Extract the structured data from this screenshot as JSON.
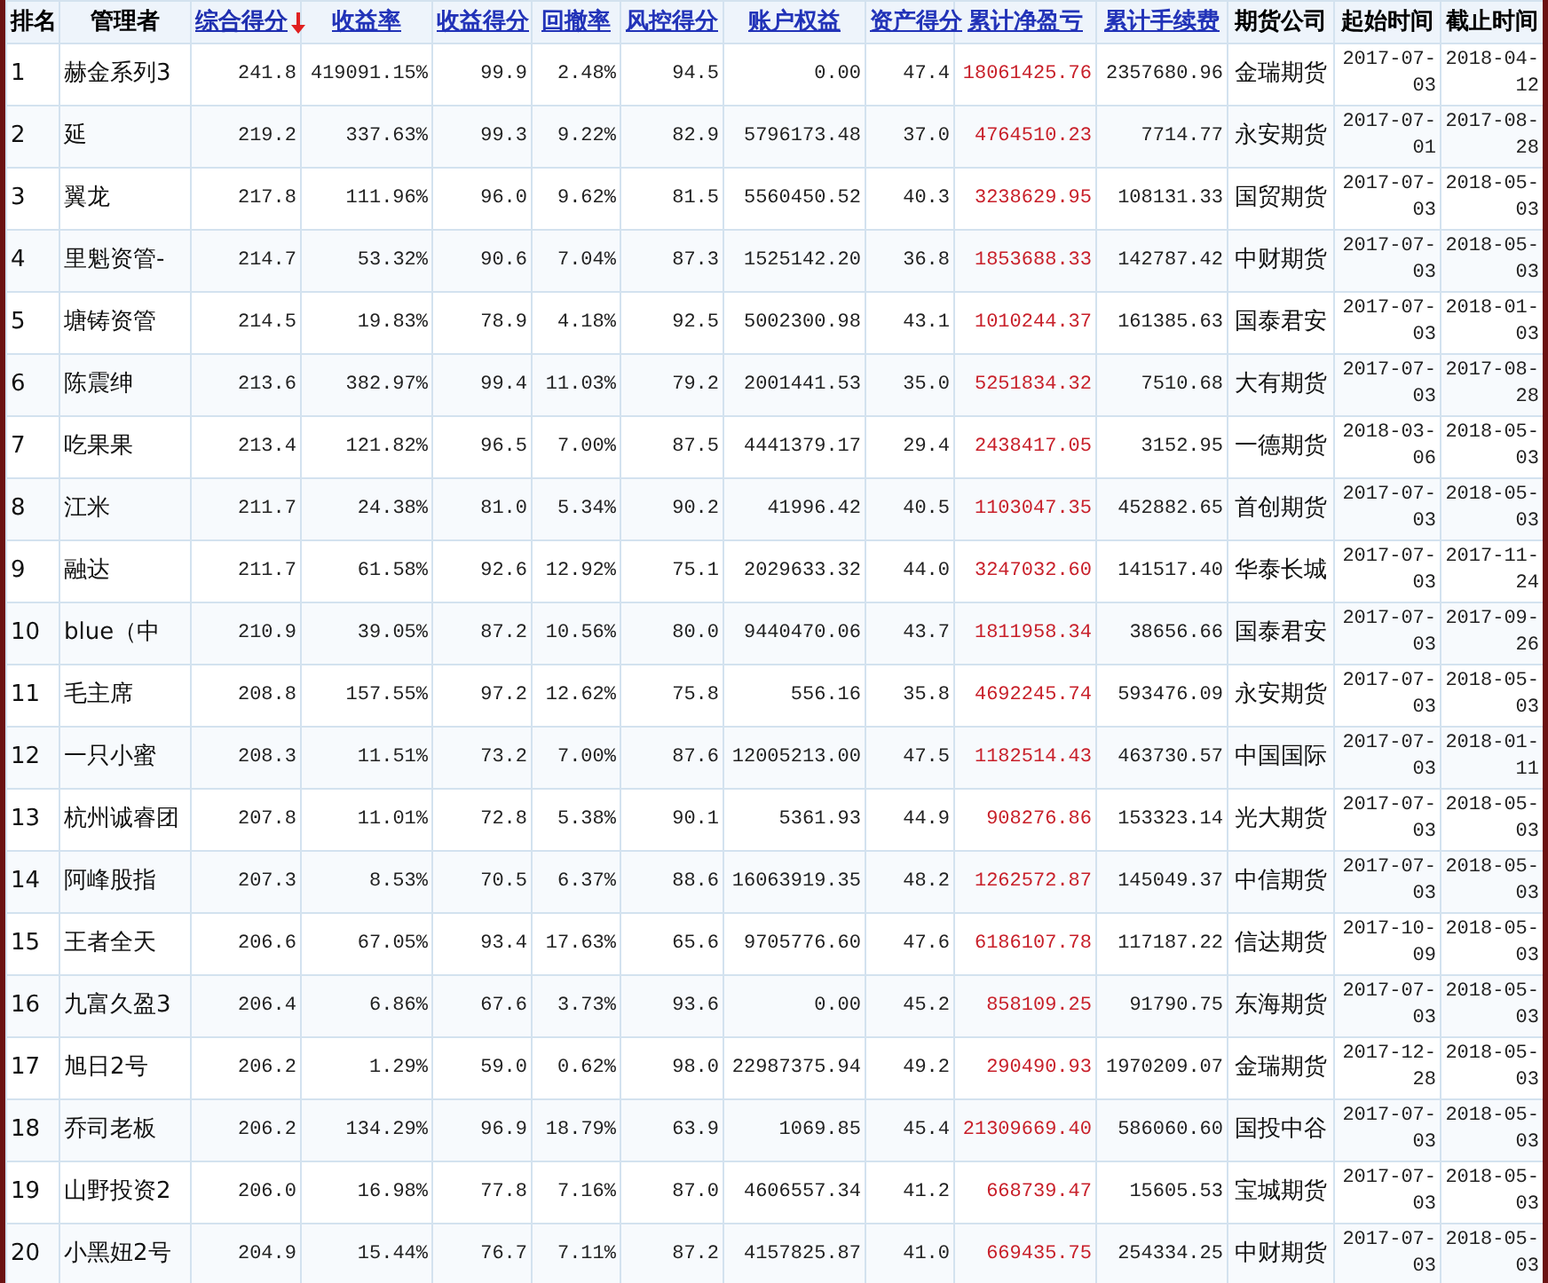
{
  "table": {
    "columns": [
      {
        "label": "排名",
        "kind": "plain"
      },
      {
        "label": "管理者",
        "kind": "plain"
      },
      {
        "label": "综合得分",
        "kind": "link",
        "sorted": true
      },
      {
        "label": "收益率",
        "kind": "link",
        "sorted": false
      },
      {
        "label": "收益得分",
        "kind": "link",
        "sorted": false
      },
      {
        "label": "回撤率",
        "kind": "link",
        "sorted": false
      },
      {
        "label": "风控得分",
        "kind": "link",
        "sorted": false
      },
      {
        "label": "账户权益",
        "kind": "link",
        "sorted": false
      },
      {
        "label": "资产得分",
        "kind": "link",
        "sorted": false
      },
      {
        "label": "累计净盈亏",
        "kind": "link",
        "sorted": false
      },
      {
        "label": "累计手续费",
        "kind": "link",
        "sorted": false
      },
      {
        "label": "期货公司",
        "kind": "plain"
      },
      {
        "label": "起始时间",
        "kind": "plain"
      },
      {
        "label": "截止时间",
        "kind": "plain"
      }
    ],
    "rows": [
      [
        "1",
        "赫金系列3",
        "241.8",
        "419091.15%",
        "99.9",
        "2.48%",
        "94.5",
        "0.00",
        "47.4",
        "18061425.76",
        "2357680.96",
        "金瑞期货",
        "2017-07-03",
        "2018-04-12"
      ],
      [
        "2",
        "延",
        "219.2",
        "337.63%",
        "99.3",
        "9.22%",
        "82.9",
        "5796173.48",
        "37.0",
        "4764510.23",
        "7714.77",
        "永安期货",
        "2017-07-01",
        "2017-08-28"
      ],
      [
        "3",
        "翼龙",
        "217.8",
        "111.96%",
        "96.0",
        "9.62%",
        "81.5",
        "5560450.52",
        "40.3",
        "3238629.95",
        "108131.33",
        "国贸期货",
        "2017-07-03",
        "2018-05-03"
      ],
      [
        "4",
        "里魁资管-",
        "214.7",
        "53.32%",
        "90.6",
        "7.04%",
        "87.3",
        "1525142.20",
        "36.8",
        "1853688.33",
        "142787.42",
        "中财期货",
        "2017-07-03",
        "2018-05-03"
      ],
      [
        "5",
        "塘铸资管",
        "214.5",
        "19.83%",
        "78.9",
        "4.18%",
        "92.5",
        "5002300.98",
        "43.1",
        "1010244.37",
        "161385.63",
        "国泰君安",
        "2017-07-03",
        "2018-01-03"
      ],
      [
        "6",
        "陈震绅",
        "213.6",
        "382.97%",
        "99.4",
        "11.03%",
        "79.2",
        "2001441.53",
        "35.0",
        "5251834.32",
        "7510.68",
        "大有期货",
        "2017-07-03",
        "2017-08-28"
      ],
      [
        "7",
        "吃果果",
        "213.4",
        "121.82%",
        "96.5",
        "7.00%",
        "87.5",
        "4441379.17",
        "29.4",
        "2438417.05",
        "3152.95",
        "一德期货",
        "2018-03-06",
        "2018-05-03"
      ],
      [
        "8",
        "江米",
        "211.7",
        "24.38%",
        "81.0",
        "5.34%",
        "90.2",
        "41996.42",
        "40.5",
        "1103047.35",
        "452882.65",
        "首创期货",
        "2017-07-03",
        "2018-05-03"
      ],
      [
        "9",
        "融达",
        "211.7",
        "61.58%",
        "92.6",
        "12.92%",
        "75.1",
        "2029633.32",
        "44.0",
        "3247032.60",
        "141517.40",
        "华泰长城",
        "2017-07-03",
        "2017-11-24"
      ],
      [
        "10",
        "blue（中",
        "210.9",
        "39.05%",
        "87.2",
        "10.56%",
        "80.0",
        "9440470.06",
        "43.7",
        "1811958.34",
        "38656.66",
        "国泰君安",
        "2017-07-03",
        "2017-09-26"
      ],
      [
        "11",
        "毛主席",
        "208.8",
        "157.55%",
        "97.2",
        "12.62%",
        "75.8",
        "556.16",
        "35.8",
        "4692245.74",
        "593476.09",
        "永安期货",
        "2017-07-03",
        "2018-05-03"
      ],
      [
        "12",
        "一只小蜜",
        "208.3",
        "11.51%",
        "73.2",
        "7.00%",
        "87.6",
        "12005213.00",
        "47.5",
        "1182514.43",
        "463730.57",
        "中国国际",
        "2017-07-03",
        "2018-01-11"
      ],
      [
        "13",
        "杭州诚睿团",
        "207.8",
        "11.01%",
        "72.8",
        "5.38%",
        "90.1",
        "5361.93",
        "44.9",
        "908276.86",
        "153323.14",
        "光大期货",
        "2017-07-03",
        "2018-05-03"
      ],
      [
        "14",
        "阿峰股指",
        "207.3",
        "8.53%",
        "70.5",
        "6.37%",
        "88.6",
        "16063919.35",
        "48.2",
        "1262572.87",
        "145049.37",
        "中信期货",
        "2017-07-03",
        "2018-05-03"
      ],
      [
        "15",
        "王者全天",
        "206.6",
        "67.05%",
        "93.4",
        "17.63%",
        "65.6",
        "9705776.60",
        "47.6",
        "6186107.78",
        "117187.22",
        "信达期货",
        "2017-10-09",
        "2018-05-03"
      ],
      [
        "16",
        "九富久盈3",
        "206.4",
        "6.86%",
        "67.6",
        "3.73%",
        "93.6",
        "0.00",
        "45.2",
        "858109.25",
        "91790.75",
        "东海期货",
        "2017-07-03",
        "2018-05-03"
      ],
      [
        "17",
        "旭日2号",
        "206.2",
        "1.29%",
        "59.0",
        "0.62%",
        "98.0",
        "22987375.94",
        "49.2",
        "290490.93",
        "1970209.07",
        "金瑞期货",
        "2017-12-28",
        "2018-05-03"
      ],
      [
        "18",
        "乔司老板",
        "206.2",
        "134.29%",
        "96.9",
        "18.79%",
        "63.9",
        "1069.85",
        "45.4",
        "21309669.40",
        "586060.60",
        "国投中谷",
        "2017-07-03",
        "2018-05-03"
      ],
      [
        "19",
        "山野投资2",
        "206.0",
        "16.98%",
        "77.8",
        "7.16%",
        "87.0",
        "4606557.34",
        "41.2",
        "668739.47",
        "15605.53",
        "宝城期货",
        "2017-07-03",
        "2018-05-03"
      ],
      [
        "20",
        "小黑妞2号",
        "204.9",
        "15.44%",
        "76.7",
        "7.11%",
        "87.2",
        "4157825.87",
        "41.0",
        "669435.75",
        "254334.25",
        "中财期货",
        "2017-07-03",
        "2018-05-03"
      ]
    ]
  }
}
